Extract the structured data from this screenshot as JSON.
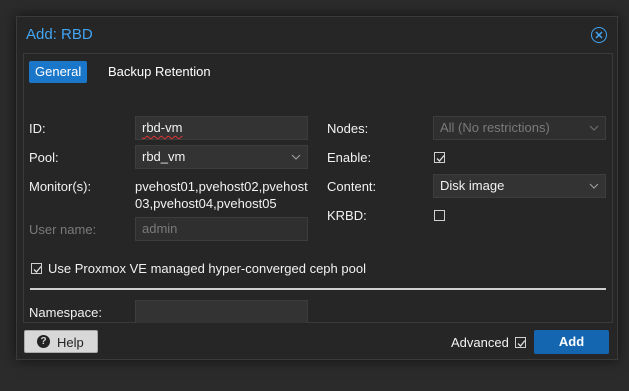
{
  "dialog": {
    "title": "Add: RBD"
  },
  "tabs": [
    {
      "label": "General"
    },
    {
      "label": "Backup Retention"
    }
  ],
  "form": {
    "id_label": "ID:",
    "id_value": "rbd-vm",
    "pool_label": "Pool:",
    "pool_value": "rbd_vm",
    "monitors_label": "Monitor(s):",
    "monitors_line1": "pvehost01,pvehost02,pvehost",
    "monitors_line2": "03,pvehost04,pvehost05",
    "username_label": "User name:",
    "username_value": "admin",
    "nodes_label": "Nodes:",
    "nodes_value": "All (No restrictions)",
    "enable_label": "Enable:",
    "enable_checked": true,
    "content_label": "Content:",
    "content_value": "Disk image",
    "krbd_label": "KRBD:",
    "krbd_checked": false,
    "managed_pool_label": "Use Proxmox VE managed hyper-converged ceph pool",
    "managed_pool_checked": true,
    "namespace_label": "Namespace:",
    "namespace_value": ""
  },
  "footer": {
    "help_label": "Help",
    "advanced_label": "Advanced",
    "advanced_checked": true,
    "add_label": "Add"
  },
  "colors": {
    "accent": "#41a5f5",
    "primary_button": "#1466b0",
    "active_tab": "#1976c8",
    "background": "#262626"
  },
  "icons": {
    "close": "close-circle-icon",
    "help": "question-circle-icon",
    "dropdown": "chevron-down-icon",
    "check": "checkmark-icon"
  }
}
